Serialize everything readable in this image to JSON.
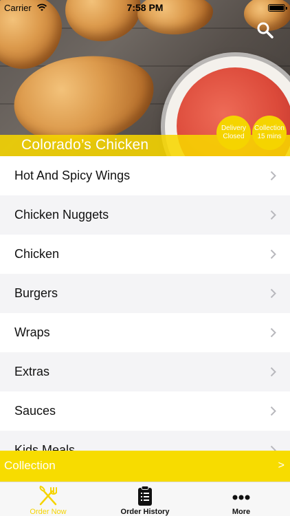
{
  "status_bar": {
    "carrier": "Carrier",
    "time": "7:58 PM"
  },
  "header": {
    "restaurant_name": "Colorado’s Chicken",
    "badges": {
      "delivery": {
        "line1": "Delivery",
        "line2": "Closed"
      },
      "collection": {
        "line1": "Collection",
        "line2": "15 mins"
      }
    },
    "search_icon": "search-icon"
  },
  "menu": {
    "items": [
      {
        "label": "Hot And Spicy Wings"
      },
      {
        "label": "Chicken Nuggets"
      },
      {
        "label": "Chicken"
      },
      {
        "label": "Burgers"
      },
      {
        "label": "Wraps"
      },
      {
        "label": "Extras"
      },
      {
        "label": "Sauces"
      },
      {
        "label": "Kids Meals"
      }
    ]
  },
  "collection_bar": {
    "label": "Collection",
    "arrow": ">"
  },
  "tabs": [
    {
      "label": "Order Now",
      "icon": "fork-knife-icon",
      "active": true
    },
    {
      "label": "Order History",
      "icon": "clipboard-list-icon",
      "active": false
    },
    {
      "label": "More",
      "icon": "more-dots-icon",
      "active": false
    }
  ],
  "colors": {
    "accent": "#F5D400",
    "list_alt_background": "#F4F4F6"
  }
}
